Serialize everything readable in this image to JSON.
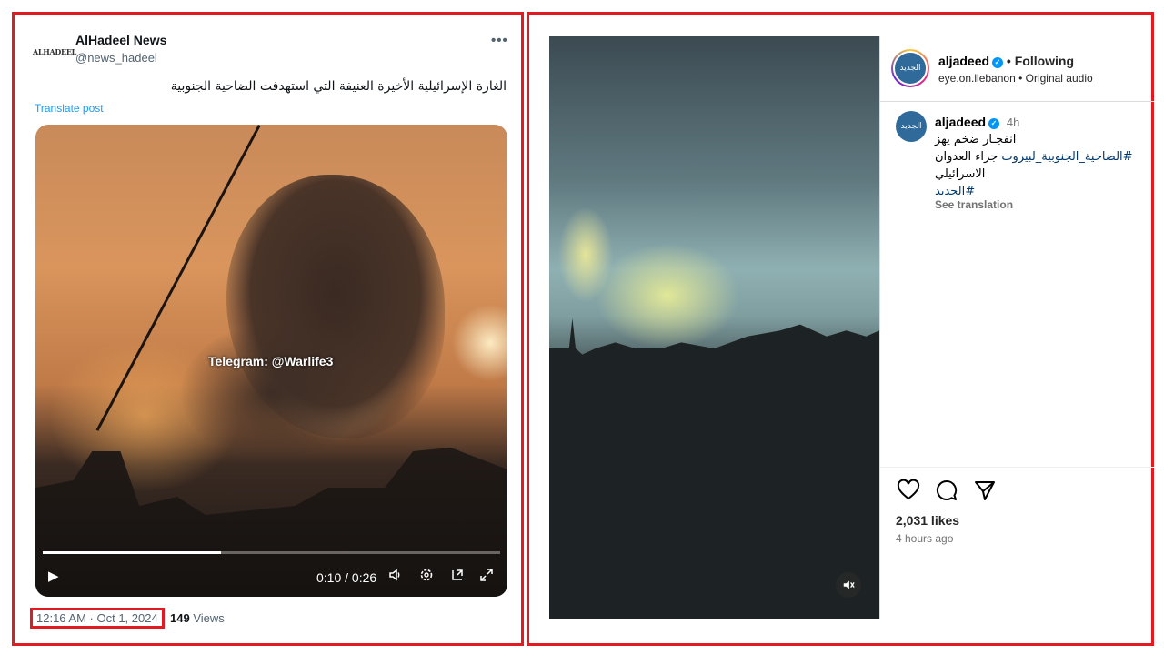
{
  "tweet": {
    "avatar_text": "ALHADEEL",
    "display_name": "AlHadeel News",
    "handle": "@news_hadeel",
    "more_icon": "•••",
    "text": "الغارة الإسرائيلية الأخيرة العنيفة التي  استهدفت  الضاحية الجنوبية",
    "translate_label": "Translate post",
    "video": {
      "watermark": "Telegram: @Warlife3",
      "time": "0:10 / 0:26",
      "progress": 0.39
    },
    "timestamp": "12:16 AM · Oct 1, 2024",
    "views_count": "149",
    "views_label": " Views"
  },
  "instagram": {
    "avatar_text": "الجديد",
    "username": "aljadeed",
    "following_label": "• Following",
    "sub_line": "eye.on.llebanon • Original audio",
    "comment": {
      "username": "aljadeed",
      "time": "4h",
      "line1": "انفجـار ضخم يهز",
      "line2_tag": "#الضاحية_الجنوبية_لبيروت",
      "line2_rest": " جراء العدوان",
      "line3": "الاسرائيلي",
      "line4_tag": "#الجديد",
      "see_translation": "See translation"
    },
    "likes": "2,031 likes",
    "posted_ago": "4 hours ago"
  },
  "colors": {
    "highlight_border": "#e11b22",
    "twitter_link": "#1d9bf0",
    "instagram_link": "#00376b",
    "verified": "#0095f6"
  },
  "icons": [
    "more-icon",
    "play-icon",
    "volume-icon",
    "settings-icon",
    "pip-icon",
    "fullscreen-icon",
    "verified-icon",
    "heart-icon",
    "comment-icon",
    "share-icon",
    "mute-icon"
  ]
}
